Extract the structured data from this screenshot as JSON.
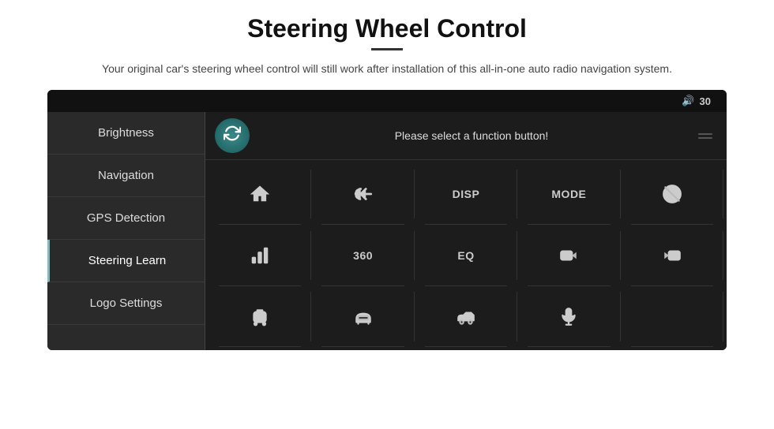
{
  "page": {
    "title": "Steering Wheel Control",
    "subtitle": "Your original car's steering wheel control will still work after installation of this all-in-one auto radio navigation system.",
    "divider": true
  },
  "topbar": {
    "volume_icon": "🔊",
    "volume_value": "30"
  },
  "sidebar": {
    "items": [
      {
        "id": "brightness",
        "label": "Brightness",
        "active": false
      },
      {
        "id": "navigation",
        "label": "Navigation",
        "active": false
      },
      {
        "id": "gps-detection",
        "label": "GPS Detection",
        "active": false
      },
      {
        "id": "steering-learn",
        "label": "Steering Learn",
        "active": true
      },
      {
        "id": "logo-settings",
        "label": "Logo Settings",
        "active": false
      }
    ]
  },
  "main": {
    "refresh_label": "↻",
    "function_prompt": "Please select a function button!",
    "grid": [
      [
        {
          "id": "home",
          "type": "svg-home",
          "label": ""
        },
        {
          "id": "back",
          "type": "svg-back",
          "label": ""
        },
        {
          "id": "disp",
          "type": "text",
          "label": "DISP"
        },
        {
          "id": "mode",
          "type": "text",
          "label": "MODE"
        },
        {
          "id": "mute-call",
          "type": "svg-mute-call",
          "label": ""
        }
      ],
      [
        {
          "id": "equalizer-bars",
          "type": "svg-eq-bars",
          "label": ""
        },
        {
          "id": "360",
          "type": "text",
          "label": "360"
        },
        {
          "id": "eq",
          "type": "text",
          "label": "EQ"
        },
        {
          "id": "beer-left",
          "type": "svg-beer",
          "label": ""
        },
        {
          "id": "beer-right",
          "type": "svg-beer2",
          "label": ""
        }
      ],
      [
        {
          "id": "car-top",
          "type": "svg-car-top",
          "label": ""
        },
        {
          "id": "car-front",
          "type": "svg-car-front",
          "label": ""
        },
        {
          "id": "car-side",
          "type": "svg-car-side",
          "label": ""
        },
        {
          "id": "microphone",
          "type": "svg-mic",
          "label": ""
        },
        {
          "id": "empty",
          "type": "empty",
          "label": ""
        }
      ]
    ]
  }
}
